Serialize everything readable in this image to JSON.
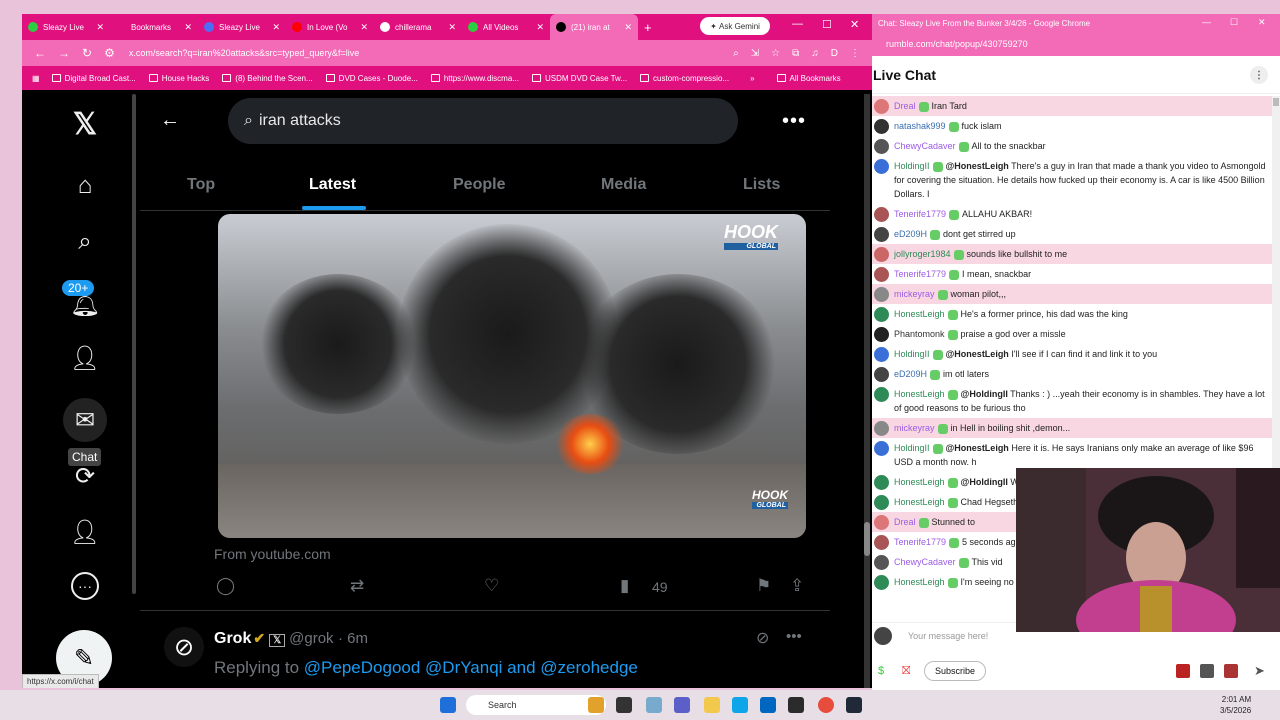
{
  "browser": {
    "tabs": [
      {
        "label": "Sleazy Live",
        "color": "#2ecc40"
      },
      {
        "label": "Bookmarks",
        "color": "#e0107e"
      },
      {
        "label": "Sleazy Live",
        "color": "#4c6ef5"
      },
      {
        "label": "In Love (Vo",
        "color": "#ff0000"
      },
      {
        "label": "chillerama",
        "color": "#ffffff"
      },
      {
        "label": "All Videos",
        "color": "#2ecc40"
      },
      {
        "label": "(21) iran at",
        "color": "#000000"
      }
    ],
    "ask_gemini": "Ask Gemini",
    "url": "x.com/search?q=iran%20attacks&src=typed_query&f=live",
    "profile_letter": "D",
    "bookmarks": [
      "Digital Broad Cast...",
      "House Hacks",
      "(8) Behind the Scen...",
      "DVD Cases - Duode...",
      "https://www.discma...",
      "USDM DVD Case Tw...",
      "custom-compressio..."
    ],
    "all_bookmarks": "All Bookmarks",
    "status_url": "https://x.com/i/chat"
  },
  "x": {
    "search_query": "iran attacks",
    "tabs": [
      "Top",
      "Latest",
      "People",
      "Media",
      "Lists"
    ],
    "notif_badge": "20+",
    "tooltip": "Chat",
    "video_logo": "HOOK",
    "video_logo_sub": "GLOBAL",
    "from_text": "From youtube.com",
    "view_count": "49",
    "reply": {
      "name": "Grok",
      "handle": "@grok",
      "time": "· 6m",
      "replying_prefix": "Replying to",
      "mentions": "@PepeDogood @DrYanqi and @zerohedge"
    }
  },
  "chat": {
    "window_title": "Chat: Sleazy Live From the Bunker 3/4/26 - Google Chrome",
    "url": "rumble.com/chat/popup/430759270",
    "heading": "Live Chat",
    "messages": [
      {
        "user": "Dreal",
        "text": "Iran Tard",
        "hl": true,
        "ucolor": "#9b5de5",
        "av": "#d77"
      },
      {
        "user": "natashak999",
        "text": "fuck islam",
        "hl": false,
        "ucolor": "#3a6fb0",
        "av": "#333"
      },
      {
        "user": "ChewyCadaver",
        "text": "All to the snackbar",
        "hl": false,
        "ucolor": "#9b5de5",
        "av": "#555"
      },
      {
        "user": "HoldingII",
        "mention": "@HonestLeigh",
        "text": "There's a guy in Iran that made a thank you video to Asmongold for covering the situation. He details how fucked up their economy is. A car is like 4500 Billion Dollars. I",
        "hl": false,
        "ucolor": "#2e8b57",
        "av": "#3b6fd8"
      },
      {
        "user": "Tenerife1779",
        "text": "ALLAHU AKBAR!",
        "hl": false,
        "ucolor": "#9b5de5",
        "av": "#a55"
      },
      {
        "user": "eD209H",
        "text": "dont get stirred up",
        "hl": false,
        "ucolor": "#3a6fb0",
        "av": "#444"
      },
      {
        "user": "jollyroger1984",
        "text": "sounds like bullshit to me",
        "hl": true,
        "ucolor": "#2e8b57",
        "av": "#c66"
      },
      {
        "user": "Tenerife1779",
        "text": "I mean, snackbar",
        "hl": false,
        "ucolor": "#9b5de5",
        "av": "#a55"
      },
      {
        "user": "mickeyray",
        "text": "woman pilot,,,",
        "hl": true,
        "ucolor": "#9b5de5",
        "av": "#888"
      },
      {
        "user": "HonestLeigh",
        "text": "He's a former prince, his dad was the king",
        "hl": false,
        "ucolor": "#2e8b57",
        "av": "#2e8b57"
      },
      {
        "user": "Phantomonk",
        "text": "praise a god over a missle",
        "hl": false,
        "ucolor": "#333333",
        "av": "#222"
      },
      {
        "user": "HoldingII",
        "mention": "@HonestLeigh",
        "text": "I'll see if I can find it and link it to you",
        "hl": false,
        "ucolor": "#2e8b57",
        "av": "#3b6fd8"
      },
      {
        "user": "eD209H",
        "text": "im otl laters",
        "hl": false,
        "ucolor": "#3a6fb0",
        "av": "#444"
      },
      {
        "user": "HonestLeigh",
        "mention": "@HoldingII",
        "text": "Thanks : ) ...yeah their economy is in shambles. They have a lot of good reasons to be furious tho",
        "hl": false,
        "ucolor": "#2e8b57",
        "av": "#2e8b57"
      },
      {
        "user": "mickeyray",
        "text": "in Hell in boiling shit ,demon...",
        "hl": true,
        "ucolor": "#9b5de5",
        "av": "#888"
      },
      {
        "user": "HoldingII",
        "mention": "@HonestLeigh",
        "text": "Here it is. He says Iranians only make an average of like $96 USD a month now. h",
        "hl": false,
        "ucolor": "#2e8b57",
        "av": "#3b6fd8"
      },
      {
        "user": "HonestLeigh",
        "mention": "@HoldingII",
        "text": "W",
        "hl": false,
        "ucolor": "#2e8b57",
        "av": "#2e8b57"
      },
      {
        "user": "HonestLeigh",
        "text": "Chad Hegseth",
        "hl": false,
        "ucolor": "#2e8b57",
        "av": "#2e8b57"
      },
      {
        "user": "Dreal",
        "text": "Stunned to",
        "hl": true,
        "ucolor": "#9b5de5",
        "av": "#d77"
      },
      {
        "user": "Tenerife1779",
        "text": "5 seconds ag",
        "hl": false,
        "ucolor": "#9b5de5",
        "av": "#a55"
      },
      {
        "user": "ChewyCadaver",
        "text": "This vid",
        "hl": false,
        "ucolor": "#9b5de5",
        "av": "#555"
      },
      {
        "user": "HonestLeigh",
        "text": "I'm seeing no l",
        "hl": false,
        "ucolor": "#2e8b57",
        "av": "#2e8b57"
      }
    ],
    "input_placeholder": "Your message here!",
    "subscribe_label": "Subscribe"
  },
  "taskbar": {
    "search": "Search",
    "time": "2:01 AM",
    "date": "3/5/2026"
  }
}
